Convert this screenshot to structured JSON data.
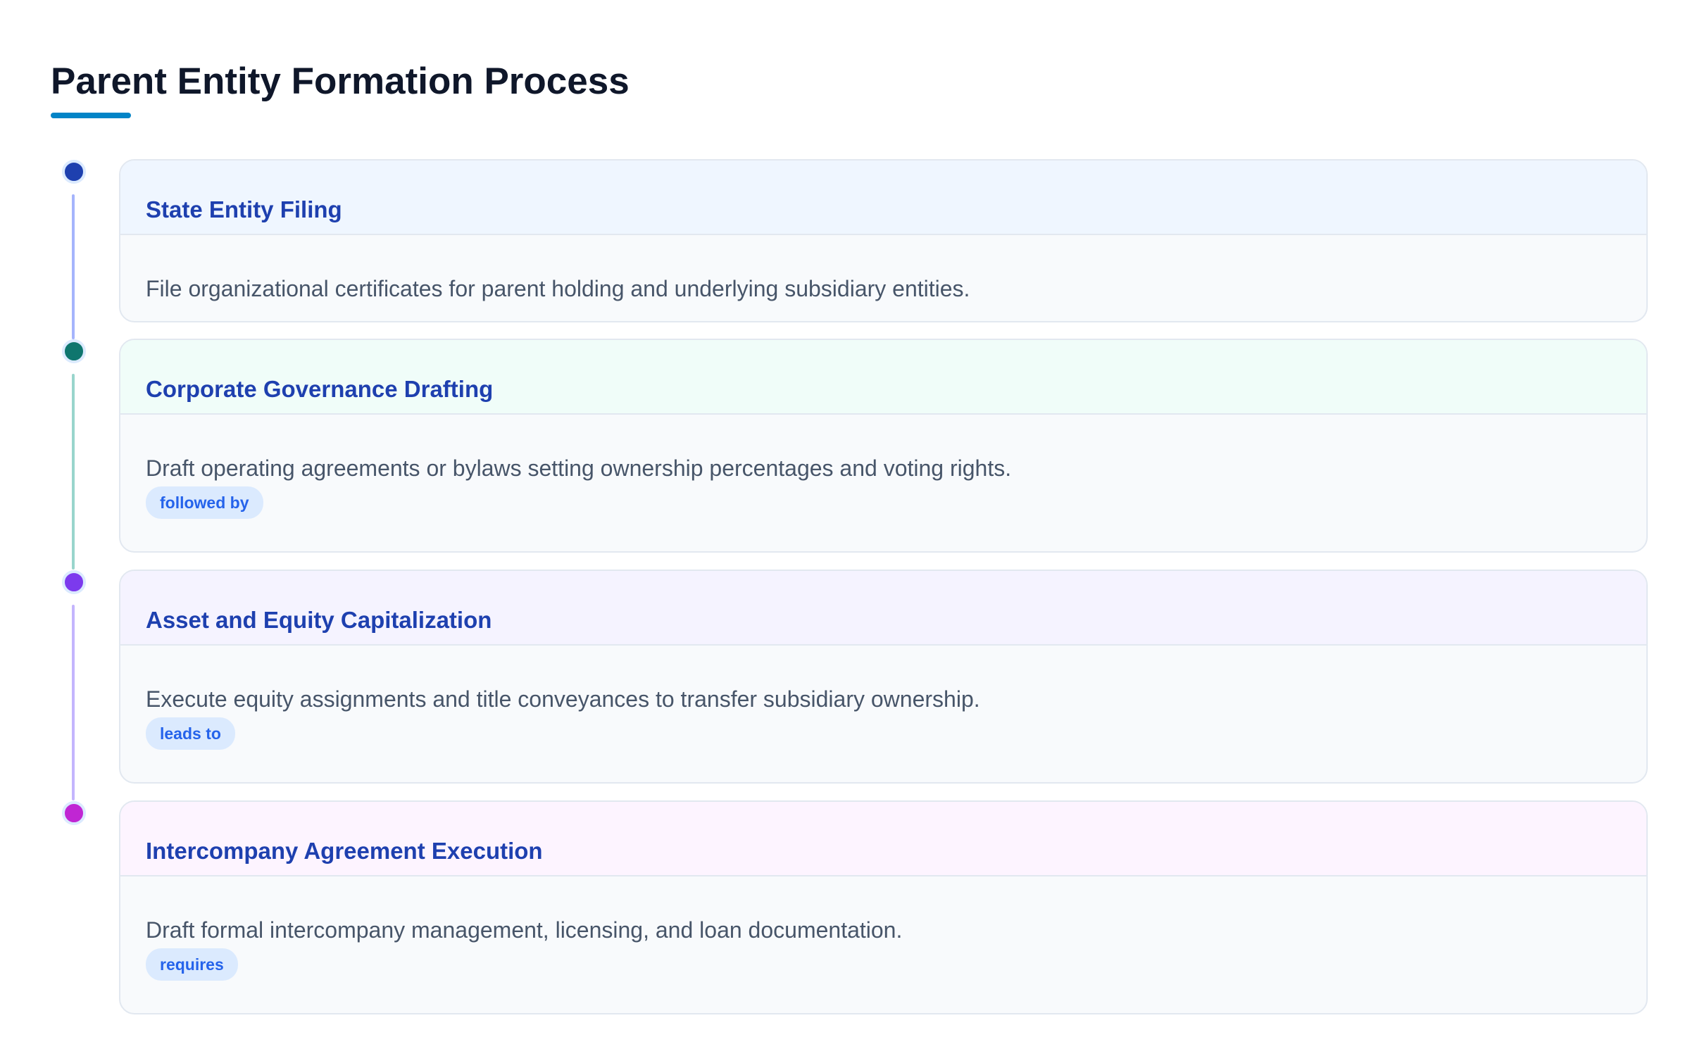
{
  "title": "Parent Entity Formation Process",
  "colors": {
    "accent_underline": "#0284c7",
    "card_title": "#1e40af",
    "badge_bg": "#dbeafe",
    "badge_text": "#2563eb"
  },
  "steps": [
    {
      "title": "State Entity Filing",
      "description": "File organizational certificates for parent holding and underlying subsidiary entities.",
      "dot_color": "#1e40af",
      "line_color": "#a5b4fc",
      "header_bg": "#eff6ff"
    },
    {
      "title": "Corporate Governance Drafting",
      "description": "Draft operating agreements or bylaws setting ownership percentages and voting rights.",
      "badge": "followed by",
      "dot_color": "#0f766e",
      "line_color": "#99d5cc",
      "header_bg": "#f0fdf9"
    },
    {
      "title": "Asset and Equity Capitalization",
      "description": "Execute equity assignments and title conveyances to transfer subsidiary ownership.",
      "badge": "leads to",
      "dot_color": "#7c3aed",
      "line_color": "#c4b5fd",
      "header_bg": "#f5f3ff"
    },
    {
      "title": "Intercompany Agreement Execution",
      "description": "Draft formal intercompany management, licensing, and loan documentation.",
      "badge": "requires",
      "dot_color": "#c026d3",
      "header_bg": "#fdf4ff"
    }
  ]
}
